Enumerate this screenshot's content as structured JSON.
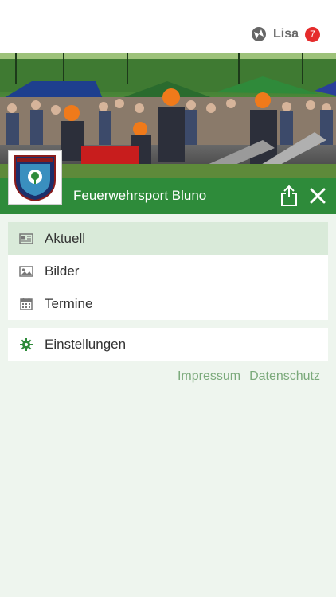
{
  "header": {
    "user_name": "Lisa",
    "notification_count": "7"
  },
  "club": {
    "title": "Feuerwehrsport Bluno"
  },
  "menu": {
    "primary": [
      {
        "label": "Aktuell",
        "icon": "newspaper-icon",
        "active": true
      },
      {
        "label": "Bilder",
        "icon": "image-icon",
        "active": false
      },
      {
        "label": "Termine",
        "icon": "calendar-icon",
        "active": false
      }
    ],
    "secondary": [
      {
        "label": "Einstellungen",
        "icon": "gear-icon",
        "active": false
      }
    ]
  },
  "footer": {
    "impressum": "Impressum",
    "datenschutz": "Datenschutz"
  },
  "colors": {
    "accent": "#2e8b3a",
    "active_bg": "#d9ead9",
    "badge": "#e52b2b",
    "link": "#7aa97a"
  }
}
